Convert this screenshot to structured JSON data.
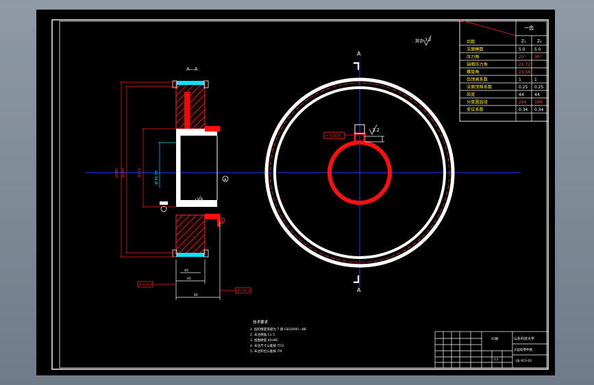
{
  "section_label": "A—A",
  "cut_marker": "A",
  "roughness_general": "3.2",
  "roughness_marks": [
    "1.6",
    "3.2",
    "1.6",
    "3.2"
  ],
  "datum_tags": [
    "A",
    "B"
  ],
  "tolerance_frames": [
    "Ø 0.03 A",
    "Ø 0.05 A",
    "= 0.02 A"
  ],
  "dimensions": {
    "vertical": [
      "Ø300",
      "Ø294",
      "Ø110",
      "Ø 65 H7"
    ],
    "horizontal": [
      "40",
      "45",
      "60",
      "18"
    ]
  },
  "parameter_table": {
    "title": "一齿",
    "headers": [
      "",
      "Z₁",
      "Z₂"
    ],
    "rows": [
      {
        "label": "齿数",
        "v1": "",
        "v2": ""
      },
      {
        "label": "法面模数",
        "v1": "5.0",
        "v2": "5.0"
      },
      {
        "label": "压力角",
        "v1": "20°",
        "v2": "30°"
      },
      {
        "label": "端面压力角",
        "v1": "21.72°",
        "v2": ""
      },
      {
        "label": "螺旋角",
        "v1": "23.56°",
        "v2": ""
      },
      {
        "label": "齿顶高系数",
        "v1": "1",
        "v2": "1"
      },
      {
        "label": "法面顶隙系数",
        "v1": "0.25",
        "v2": "0.25"
      },
      {
        "label": "齿宽",
        "v1": "44",
        "v2": "44"
      },
      {
        "label": "分度圆直径",
        "v1": "294",
        "v2": "100"
      },
      {
        "label": "变位系数",
        "v1": "0.34",
        "v2": "0.34"
      }
    ]
  },
  "tech_requirements": {
    "title": "技术要求",
    "items": [
      "1. 齿轮精度等级为 7 级 GB10095—88",
      "2. 未注倒角 C1.5",
      "3. 齿面硬度 45HRC",
      "4. 未注尺寸公差按 IT12",
      "5. 未注形位公差按 IT9"
    ]
  },
  "title_block": {
    "school": "山东科技大学",
    "part_name": "大齿轮零件图",
    "drawing_no": "JSJ-SCS-02",
    "material": "45钢",
    "scale": "1:2"
  }
}
